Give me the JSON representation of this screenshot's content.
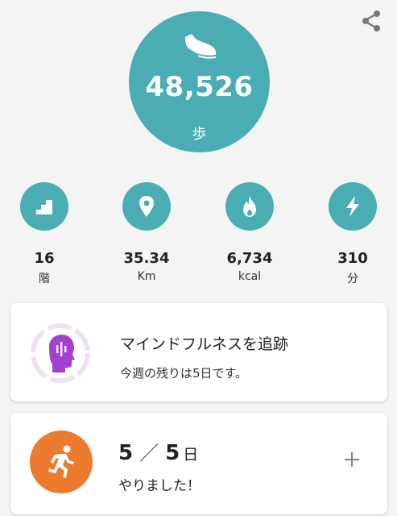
{
  "summary": {
    "steps": "48,526",
    "steps_unit": "歩"
  },
  "stats": [
    {
      "icon": "stairs-icon",
      "value": "16",
      "unit": "階"
    },
    {
      "icon": "location-pin-icon",
      "value": "35.34",
      "unit": "Km"
    },
    {
      "icon": "flame-icon",
      "value": "6,734",
      "unit": "kcal"
    },
    {
      "icon": "lightning-bolt-icon",
      "value": "310",
      "unit": "分"
    }
  ],
  "mindfulness": {
    "title": "マインドフルネスを追跡",
    "subtitle": "今週の残りは5日です。"
  },
  "exercise": {
    "done": "5",
    "separator": "／",
    "goal": "5",
    "goal_unit": "日",
    "subtitle": "やりました！"
  },
  "colors": {
    "teal": "#4aadb3",
    "orange": "#ec7b30",
    "purple": "#a340d0",
    "ring": "#f0e0f4"
  }
}
